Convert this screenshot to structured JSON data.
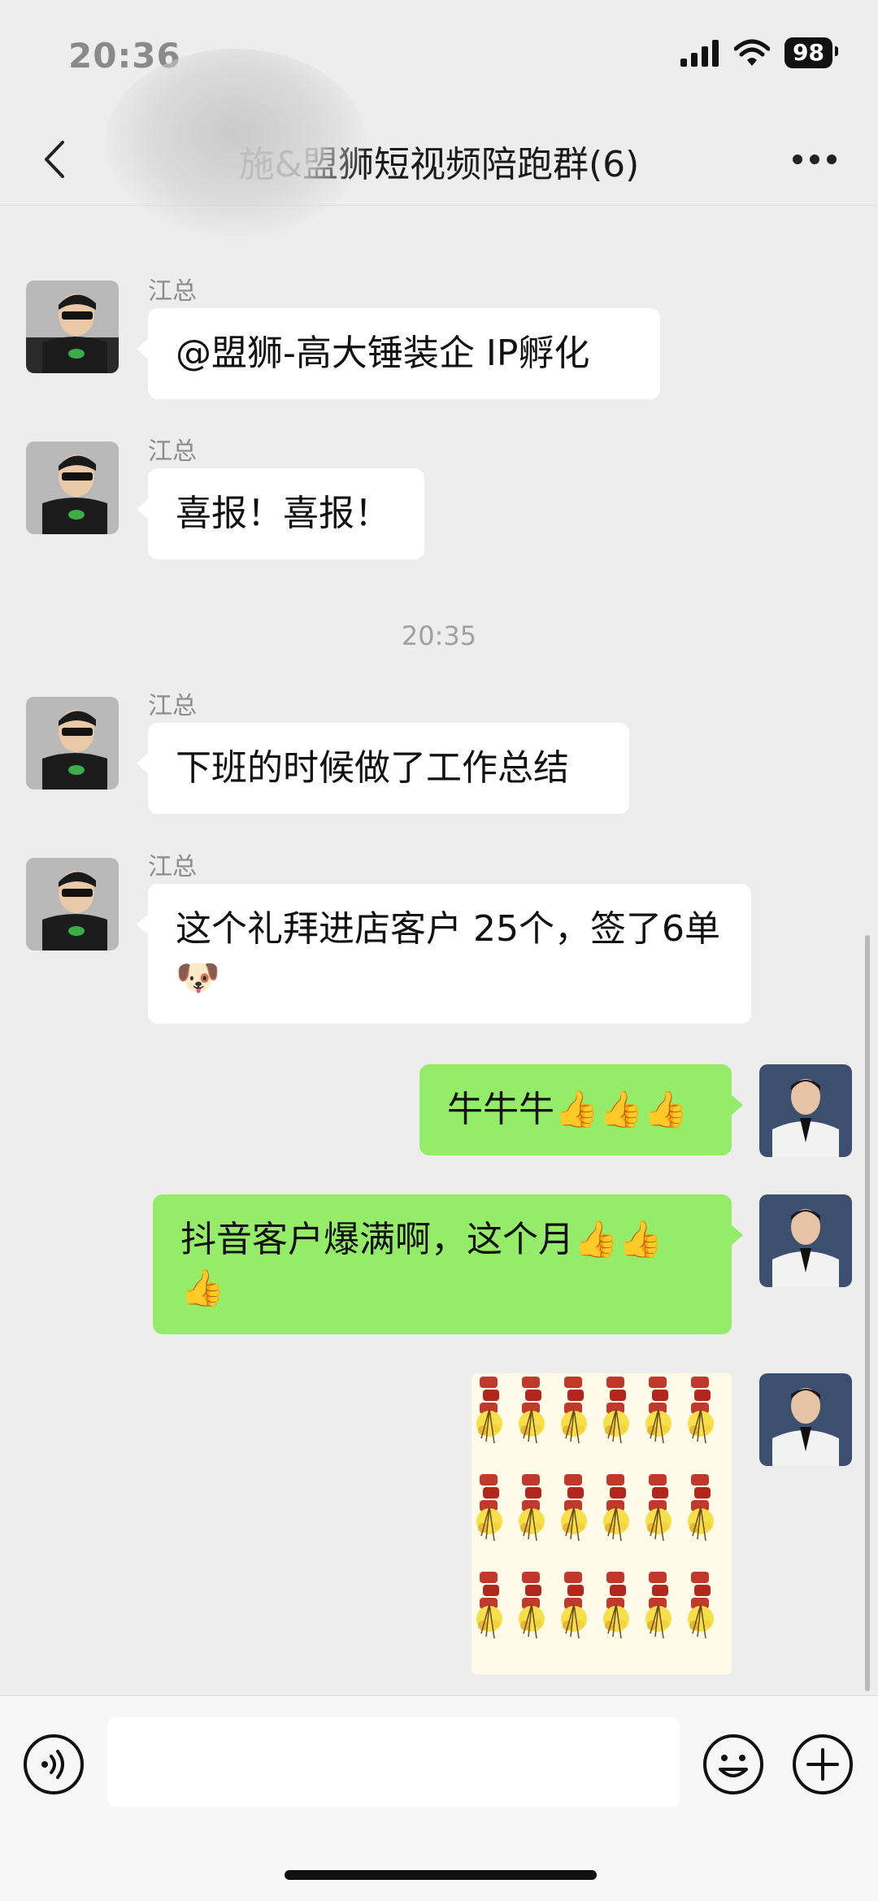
{
  "status_bar": {
    "time": "20:36",
    "battery": "98"
  },
  "nav": {
    "title": "施&盟狮短视频陪跑群(6)"
  },
  "messages": [
    {
      "sender": "江总",
      "text": "@盟狮-高大锤装企 IP孵化"
    },
    {
      "sender": "江总",
      "text": "喜报！喜报！"
    },
    {
      "timestamp": "20:35"
    },
    {
      "sender": "江总",
      "text": "下班的时候做了工作总结"
    },
    {
      "sender": "江总",
      "text": "这个礼拜进店客户 25个，签了6单🐶"
    },
    {
      "text": "牛牛牛👍👍👍"
    },
    {
      "text": "抖音客户爆满啊，这个月👍👍👍"
    }
  ],
  "icons": [
    "back-icon",
    "more-icon",
    "voice-icon",
    "emoji-icon",
    "plus-icon",
    "firecracker-sticker"
  ],
  "colors": {
    "background": "#ededed",
    "bubble_in": "#ffffff",
    "bubble_out": "#95ec69",
    "accent_dark": "#111111"
  }
}
